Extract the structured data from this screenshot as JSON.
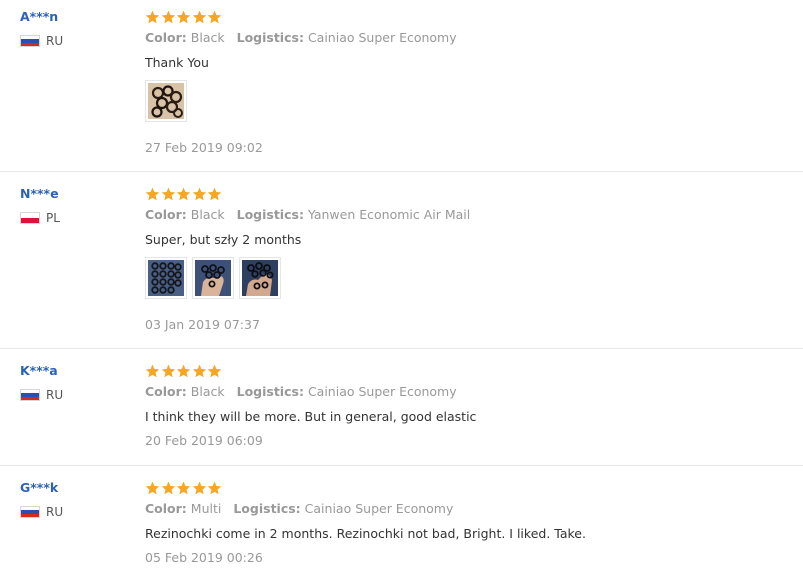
{
  "colors": {
    "accent": "#2b62b6",
    "star": "#f5a623",
    "muted": "#999999",
    "text": "#333333",
    "divider": "#e8e8e8"
  },
  "labels": {
    "color": "Color:",
    "logistics": "Logistics:"
  },
  "reviews": [
    {
      "user": "A***n",
      "country": "RU",
      "flag": "russia-flag",
      "rating": 5,
      "color": "Black",
      "logistics": "Cainiao Super Economy",
      "text": "Thank You",
      "photos": [
        "photo-hair-ties-bundle"
      ],
      "date": "27 Feb 2019 09:02"
    },
    {
      "user": "N***e",
      "country": "PL",
      "flag": "poland-flag",
      "rating": 5,
      "color": "Black",
      "logistics": "Yanwen Economic Air Mail",
      "text": "Super, but szły 2 months",
      "photos": [
        "photo-hair-ties-on-denim",
        "photo-hair-ties-in-hand",
        "photo-hair-ties-on-fingers"
      ],
      "date": "03 Jan 2019 07:37"
    },
    {
      "user": "K***a",
      "country": "RU",
      "flag": "russia-flag",
      "rating": 5,
      "color": "Black",
      "logistics": "Cainiao Super Economy",
      "text": "I think they will be more. But in general, good elastic",
      "photos": [],
      "date": "20 Feb 2019 06:09"
    },
    {
      "user": "G***k",
      "country": "RU",
      "flag": "russia-flag",
      "rating": 5,
      "color": "Multi",
      "logistics": "Cainiao Super Economy",
      "text": "Rezinochki come in 2 months. Rezinochki not bad, Bright. I liked. Take.",
      "photos": [],
      "date": "05 Feb 2019 00:26"
    }
  ]
}
